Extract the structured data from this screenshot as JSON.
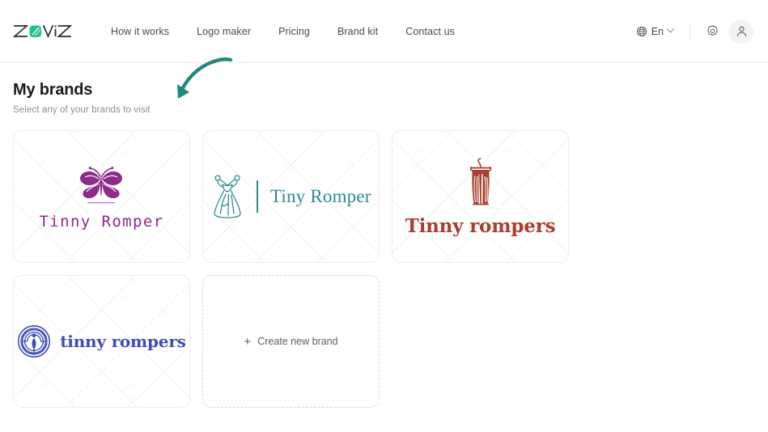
{
  "header": {
    "logo_text": "ZOVIZ",
    "logo_icon": "zoviz-logomark",
    "nav": [
      {
        "label": "How it works",
        "name": "nav-how-it-works"
      },
      {
        "label": "Logo maker",
        "name": "nav-logo-maker"
      },
      {
        "label": "Pricing",
        "name": "nav-pricing"
      },
      {
        "label": "Brand kit",
        "name": "nav-brand-kit"
      },
      {
        "label": "Contact us",
        "name": "nav-contact-us"
      }
    ],
    "language": {
      "label": "En",
      "icon": "globe-icon",
      "chevron": "chevron-down-icon"
    },
    "settings_icon": "gear-icon",
    "account_icon": "user-avatar-icon"
  },
  "main": {
    "title": "My brands",
    "subtitle": "Select any of your brands to visit",
    "create_new": {
      "label": "Create new brand",
      "plus": "+"
    },
    "watermark_text": "ZOVIZ"
  },
  "brands": [
    {
      "name": "brand-card-tinny-romper-butterfly",
      "wordmark": "Tinny Romper",
      "icon": "butterfly-icon",
      "color": "#8e2a8b",
      "layout": "stacked"
    },
    {
      "name": "brand-card-tiny-romper-dress",
      "wordmark": "Tiny Romper",
      "icon": "dress-icon",
      "color": "#2b8b95",
      "layout": "row"
    },
    {
      "name": "brand-card-tinny-rompers-hanger",
      "wordmark": "Tinny rompers",
      "icon": "garment-hanger-icon",
      "color": "#a8402f",
      "layout": "stacked"
    },
    {
      "name": "brand-card-tinny-rompers-emblem",
      "wordmark": "tinny rompers",
      "icon": "labyrinth-emblem-icon",
      "color": "#3d4db5",
      "layout": "row"
    }
  ],
  "annotation": {
    "arrow": "curved-arrow-annotation",
    "color": "#1f8a7a"
  }
}
